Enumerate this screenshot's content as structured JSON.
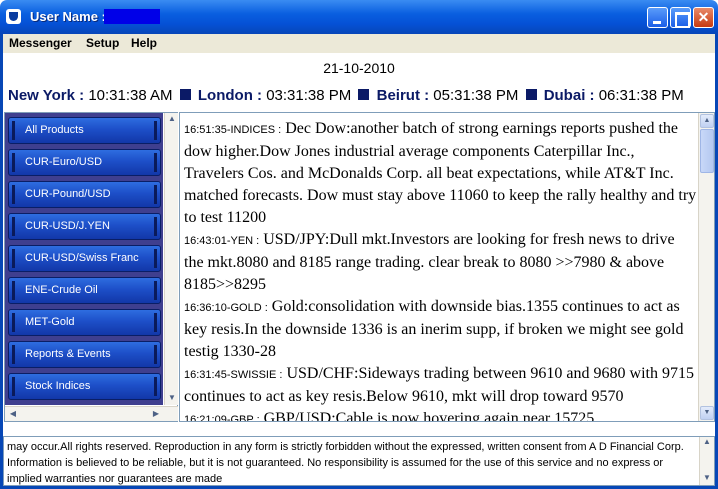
{
  "window": {
    "title_label": "User Name :"
  },
  "menu": [
    "Messenger",
    "Setup",
    "Help"
  ],
  "date": "21-10-2010",
  "clocks": [
    {
      "city": "New York :",
      "time": "10:31:38 AM"
    },
    {
      "city": "London :",
      "time": "03:31:38 PM"
    },
    {
      "city": "Beirut :",
      "time": "05:31:38 PM"
    },
    {
      "city": "Dubai :",
      "time": "06:31:38 PM"
    }
  ],
  "sidebar": {
    "items": [
      "All Products",
      "CUR-Euro/USD",
      "CUR-Pound/USD",
      "CUR-USD/J.YEN",
      "CUR-USD/Swiss Franc",
      "ENE-Crude Oil",
      "MET-Gold",
      "Reports & Events",
      "Stock Indices"
    ]
  },
  "news": [
    {
      "stamp": "16:51:35-INDICES :",
      "text": "Dec Dow:another batch of strong earnings reports pushed the dow higher.Dow Jones industrial average components Caterpillar Inc., Travelers Cos. and McDonalds Corp. all beat expectations, while AT&T Inc. matched forecasts. Dow must stay above 11060 to keep the rally healthy and try to test 11200"
    },
    {
      "stamp": "16:43:01-YEN :",
      "text": "USD/JPY:Dull mkt.Investors are looking for fresh news to drive the mkt.8080 and 8185 range trading. clear break to 8080 >>7980 & above 8185>>8295"
    },
    {
      "stamp": "16:36:10-GOLD :",
      "text": "Gold:consolidation with downside bias.1355 continues to act as key resis.In the downside 1336 is an inerim supp, if broken we might see gold testig 1330-28"
    },
    {
      "stamp": "16:31:45-SWISSIE :",
      "text": "USD/CHF:Sideways trading between 9610 and 9680 with 9715 continues to act as key resis.Below 9610, mkt will drop toward 9570"
    },
    {
      "stamp": "16:21:09-GBP :",
      "text": "GBP/USD:Cable is now hovering again near 15725"
    }
  ],
  "footer": "may occur.All rights reserved. Reproduction in any form is strictly forbidden without the expressed,  written consent from A D Financial Corp. Information is believed to be reliable, but it is not guaranteed. No responsibility is assumed for the use of this service and no express or implied warranties nor guarantees are made"
}
